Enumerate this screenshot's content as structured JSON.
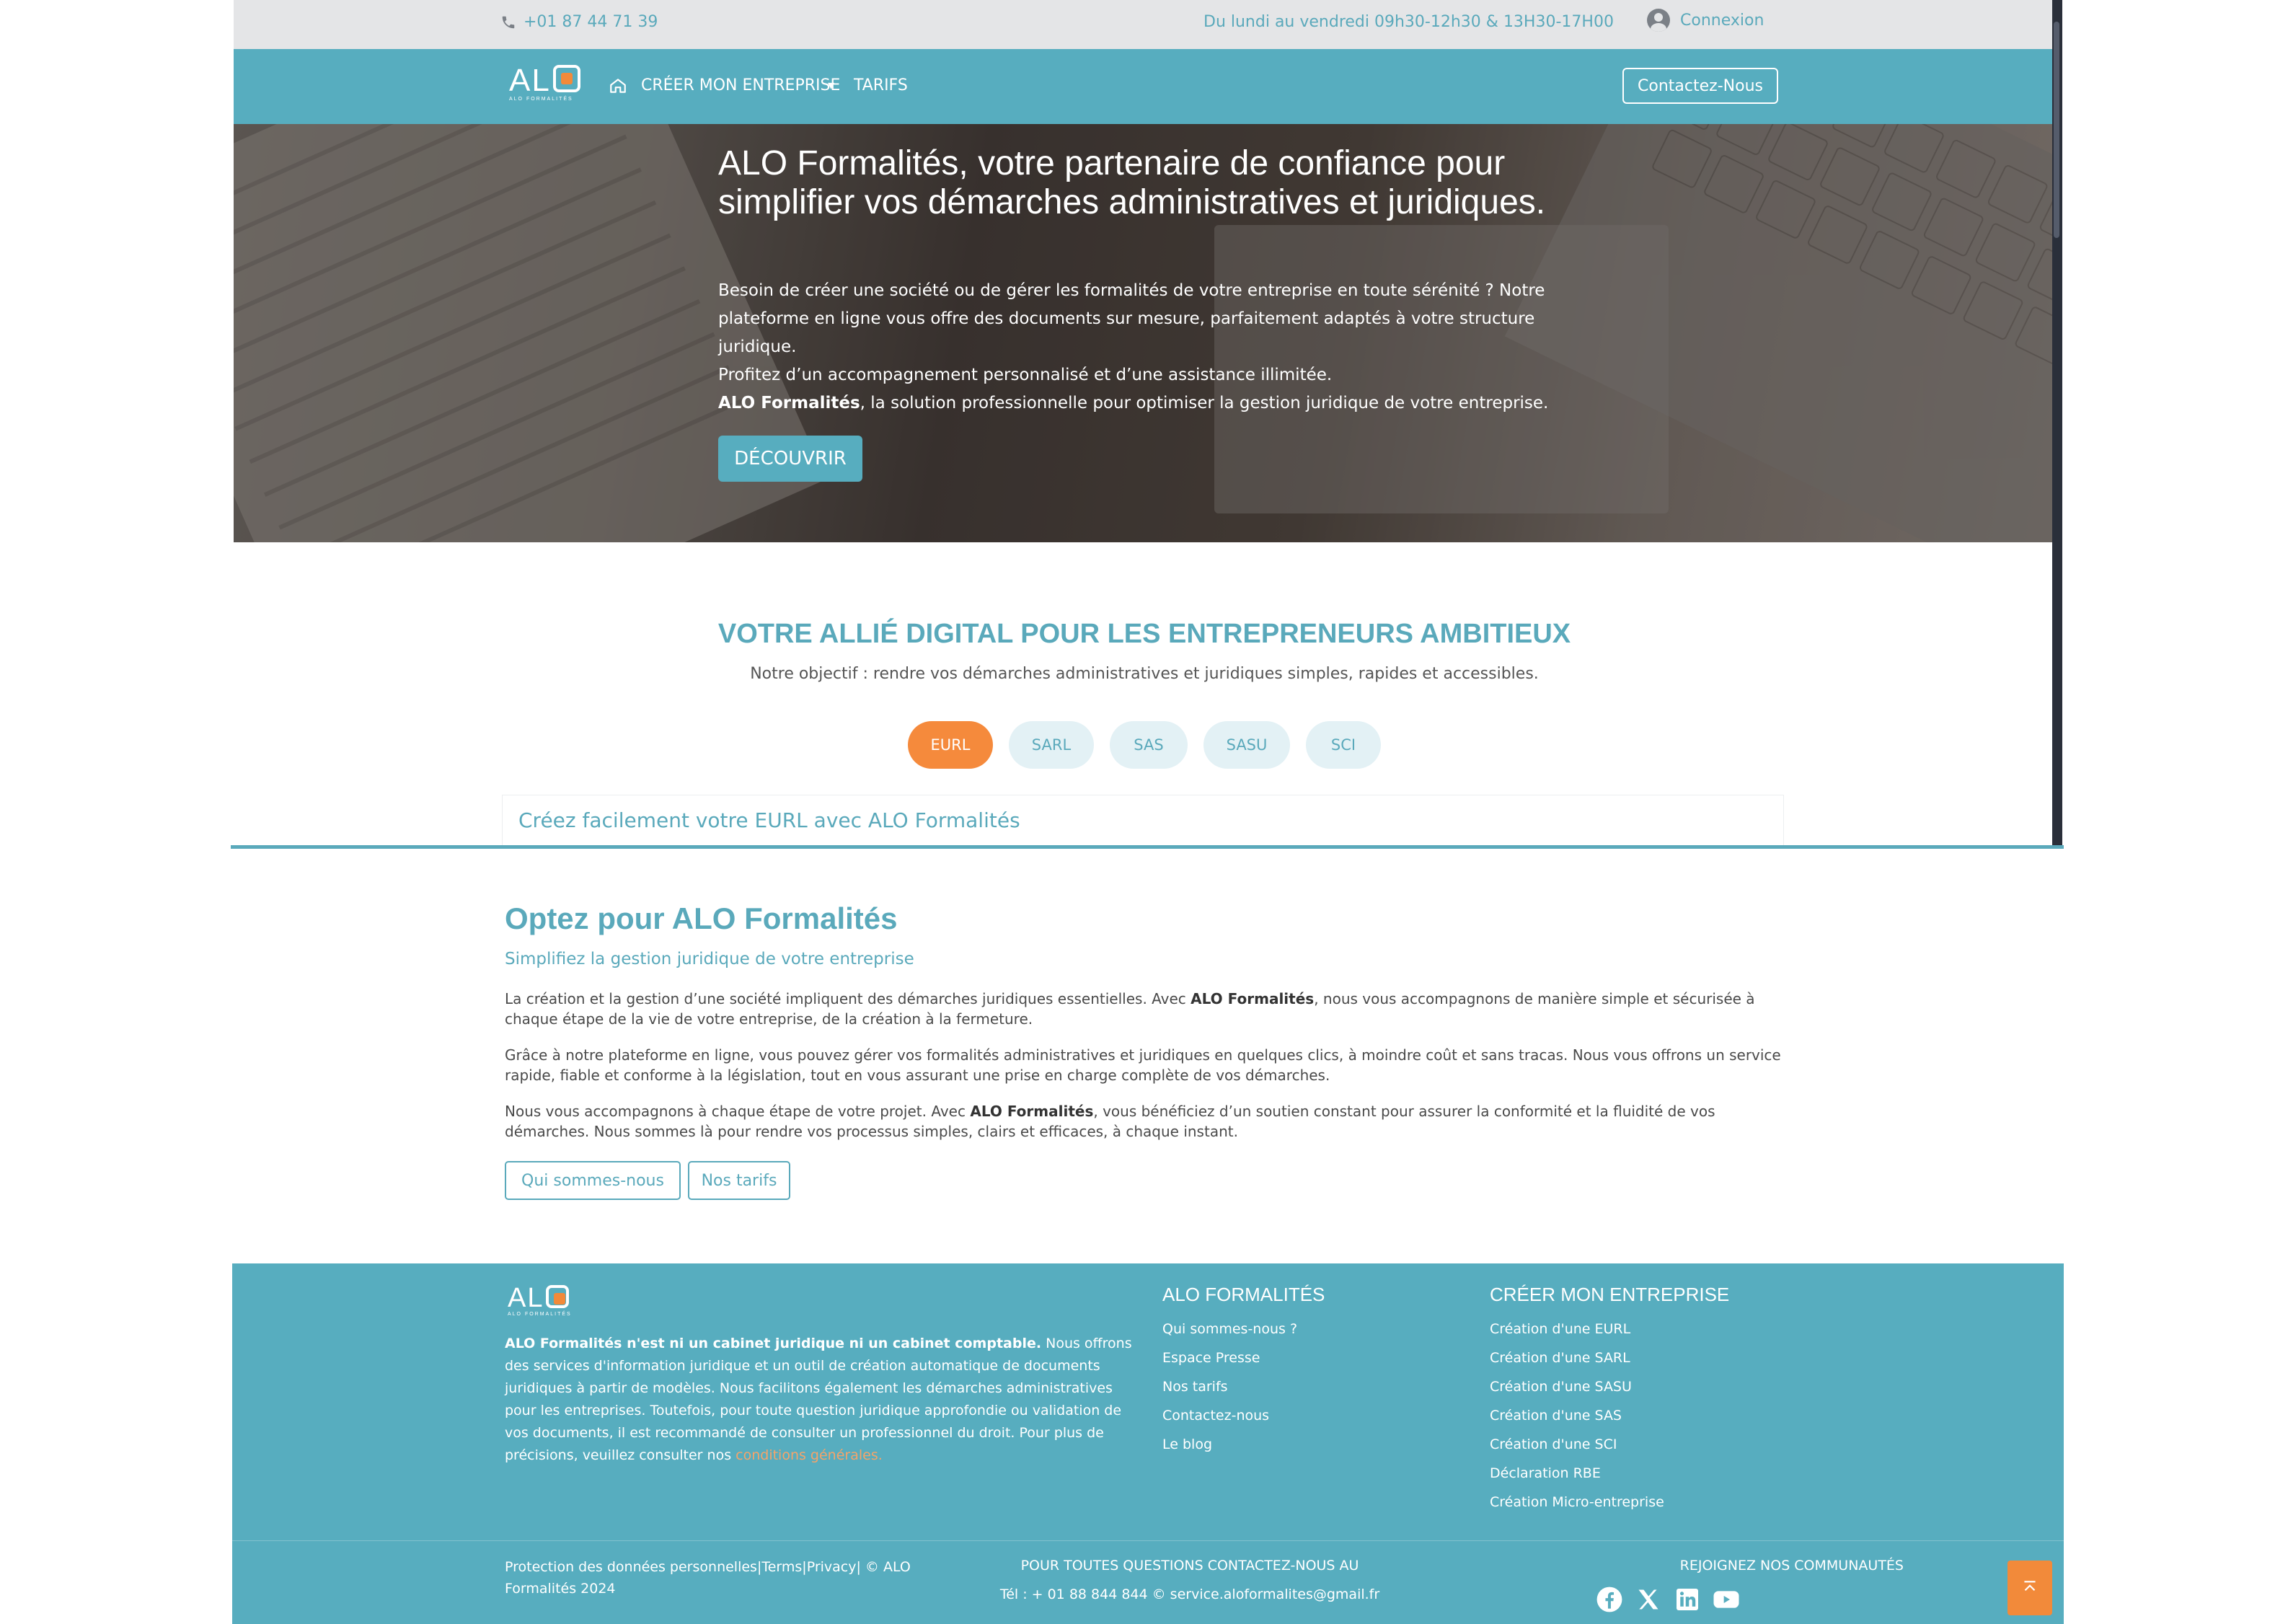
{
  "topbar": {
    "phone": "+01 87 44 71 39",
    "hours": "Du lundi au vendredi 09h30-12h30 & 13H30-17H00",
    "login": "Connexion"
  },
  "navbar": {
    "logo_text": "AL",
    "logo_sub": "ALO FORMALITÉS",
    "menu_create": "CRÉER MON ENTREPRISE",
    "menu_tarifs": "TARIFS",
    "contact": "Contactez-Nous"
  },
  "hero": {
    "title": "ALO Formalités, votre partenaire de confiance pour simplifier vos démarches administratives et juridiques.",
    "p1": "Besoin de créer une société ou de gérer les formalités de votre entreprise en toute sérénité ? Notre plateforme en ligne vous offre des documents sur mesure, parfaitement adaptés à votre structure juridique.",
    "p2": "Profitez d’un accompagnement personnalisé et d’une assistance illimitée.",
    "p3_bold": "ALO Formalités",
    "p3_rest": ", la solution professionnelle pour optimiser la gestion juridique de votre entreprise.",
    "cta": "DÉCOUVRIR"
  },
  "section1": {
    "title": "VOTRE ALLIÉ DIGITAL POUR LES ENTREPRENEURS AMBITIEUX",
    "subtitle": "Notre objectif : rendre vos démarches administratives et juridiques simples, rapides et accessibles.",
    "tabs": [
      "EURL",
      "SARL",
      "SAS",
      "SASU",
      "SCI"
    ],
    "card_title": "Créez facilement votre EURL avec ALO Formalités"
  },
  "section2": {
    "title": "Optez pour ALO Formalités",
    "subtitle": "Simplifiez la gestion juridique de votre entreprise",
    "p1a": "La création et la gestion d’une société impliquent des démarches juridiques essentielles. Avec ",
    "p1b": "ALO Formalités",
    "p1c": ", nous vous accompagnons de manière simple et sécurisée à chaque étape de la vie de votre entreprise, de la création à la fermeture.",
    "p2": "Grâce à notre plateforme en ligne, vous pouvez gérer vos formalités administratives et juridiques en quelques clics, à moindre coût et sans tracas. Nous vous offrons un service rapide, fiable et conforme à la législation, tout en vous assurant une prise en charge complète de vos démarches.",
    "p3a": "Nous vous accompagnons à chaque étape de votre projet. Avec ",
    "p3b": "ALO Formalités",
    "p3c": ", vous bénéficiez d’un soutien constant pour assurer la conformité et la fluidité de vos démarches. Nous sommes là pour rendre vos processus simples, clairs et efficaces, à chaque instant.",
    "btn_about": "Qui sommes-nous",
    "btn_pricing": "Nos tarifs"
  },
  "footer": {
    "desc_bold": "ALO Formalités n'est ni un cabinet juridique ni un cabinet comptable.",
    "desc_rest": " Nous offrons des services d'information juridique et un outil de création automatique de documents juridiques à partir de modèles. Nous facilitons également les démarches administratives pour les entreprises. Toutefois, pour toute question juridique approfondie ou validation de vos documents, il est recommandé de consulter un professionnel du droit. Pour plus de précisions, veuillez consulter nos ",
    "desc_link": "conditions générales.",
    "col1_title": "ALO FORMALITÉS",
    "col1_links": [
      "Qui sommes-nous ?",
      "Espace Presse",
      "Nos tarifs",
      "Contactez-nous",
      "Le blog"
    ],
    "col2_title": "CRÉER MON ENTREPRISE",
    "col2_links": [
      "Création d'une EURL",
      "Création d'une SARL",
      "Création d'une SASU",
      "Création d'une SAS",
      "Création d'une SCI",
      "Déclaration RBE",
      "Création Micro-entreprise"
    ],
    "legal_line1": "Protection des données personnelles|Terms|Privacy| © ALO",
    "legal_line2": "Formalités 2024",
    "contact_title": "POUR TOUTES QUESTIONS CONTACTEZ-NOUS AU",
    "contact_line": "Tél : + 01 88 844 844 © service.aloformalites@gmail.fr",
    "social_title": "REJOIGNEZ NOS COMMUNAUTÉS",
    "social_icons": [
      "facebook-icon",
      "x-icon",
      "linkedin-icon",
      "youtube-icon"
    ]
  },
  "colors": {
    "brand_teal": "#57adbf",
    "accent_orange": "#f58a3c",
    "topbar_bg": "#e4e5e7"
  }
}
